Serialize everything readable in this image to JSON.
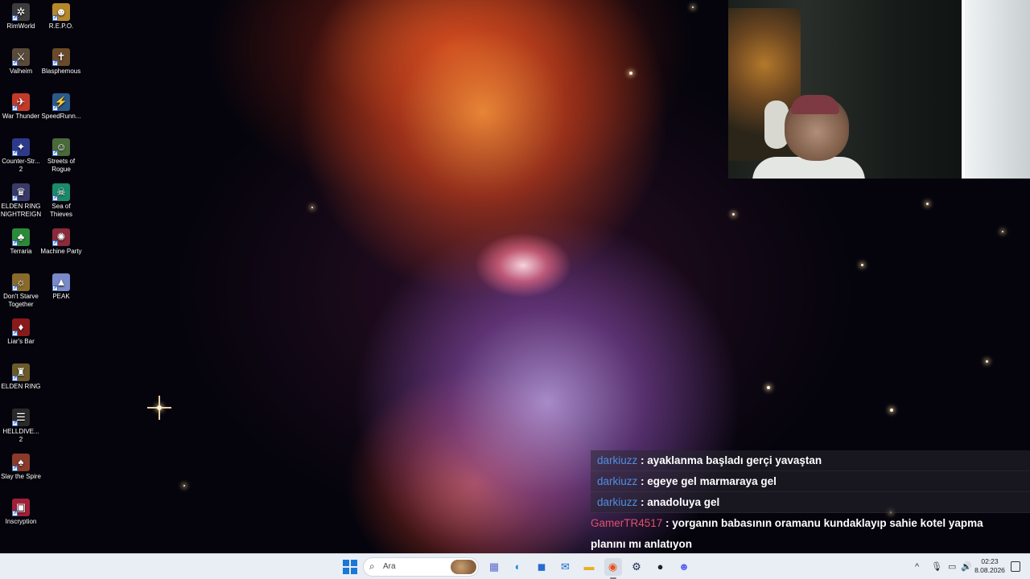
{
  "desktop": {
    "icons": [
      {
        "label": "RimWorld",
        "icon": "rimworld-icon",
        "glyph": "✲",
        "color": "#3c3c3c"
      },
      {
        "label": "R.E.P.O.",
        "icon": "repo-icon",
        "glyph": "☻",
        "color": "#b5872a"
      },
      {
        "label": "Valheim",
        "icon": "valheim-icon",
        "glyph": "⚔",
        "color": "#5a4a3a"
      },
      {
        "label": "Blasphemous",
        "icon": "blasphemous-icon",
        "glyph": "✝",
        "color": "#6b4a2b"
      },
      {
        "label": "War Thunder",
        "icon": "war-thunder-icon",
        "glyph": "✈",
        "color": "#c23a2a"
      },
      {
        "label": "SpeedRunn...",
        "icon": "speedrunners-icon",
        "glyph": "⚡",
        "color": "#2a5a8a"
      },
      {
        "label": "Counter-Str... 2",
        "icon": "counter-strike-icon",
        "glyph": "✦",
        "color": "#2d3a8c"
      },
      {
        "label": "Streets of Rogue",
        "icon": "streets-of-rogue-icon",
        "glyph": "☺",
        "color": "#4a6a3a"
      },
      {
        "label": "ELDEN RING NIGHTREIGN",
        "icon": "nightreign-icon",
        "glyph": "♛",
        "color": "#3a3a6a"
      },
      {
        "label": "Sea of Thieves",
        "icon": "sea-of-thieves-icon",
        "glyph": "☠",
        "color": "#1a8a6a"
      },
      {
        "label": "Terraria",
        "icon": "terraria-icon",
        "glyph": "♣",
        "color": "#2a8a3a"
      },
      {
        "label": "Machine Party",
        "icon": "machine-party-icon",
        "glyph": "✺",
        "color": "#8a2a3a"
      },
      {
        "label": "Don't Starve Together",
        "icon": "dont-starve-icon",
        "glyph": "☼",
        "color": "#8a6a2a"
      },
      {
        "label": "PEAK",
        "icon": "peak-icon",
        "glyph": "▲",
        "color": "#7a8ac8"
      },
      {
        "label": "Liar's Bar",
        "icon": "liars-bar-icon",
        "glyph": "♦",
        "color": "#8a1a1a"
      },
      {
        "label": "ELDEN RING",
        "icon": "elden-ring-icon",
        "glyph": "♜",
        "color": "#6a5a2a"
      },
      {
        "label": "HELLDIVE... 2",
        "icon": "helldivers-icon",
        "glyph": "☰",
        "color": "#2a2a2a"
      },
      {
        "label": "Slay the Spire",
        "icon": "slay-the-spire-icon",
        "glyph": "♠",
        "color": "#8a3a2a"
      },
      {
        "label": "Inscryption",
        "icon": "inscryption-icon",
        "glyph": "▣",
        "color": "#a0203a"
      }
    ]
  },
  "chat": {
    "messages": [
      {
        "user": "darkiuzz",
        "text": " : ayaklanma başladı gerçi yavaştan",
        "user_color": "#4f8fe0"
      },
      {
        "user": "darkiuzz",
        "text": " : egeye gel marmaraya gel",
        "user_color": "#4f8fe0"
      },
      {
        "user": "darkiuzz",
        "text": " : anadoluya gel",
        "user_color": "#4f8fe0"
      },
      {
        "user": "GamerTR4517",
        "text": " : yorganın babasının oramanu kundaklayıp sahie kotel yapma",
        "user_color": "#e0506a"
      },
      {
        "user": "",
        "text": "planını mı anlatıyon",
        "user_color": "#e0506a"
      }
    ]
  },
  "taskbar": {
    "search_placeholder": "Ara",
    "apps": [
      {
        "name": "widgets-app",
        "glyph": "▦",
        "color": "#5a6acf"
      },
      {
        "name": "edge-app",
        "glyph": "◐",
        "color": "#1a8ae0"
      },
      {
        "name": "store-app",
        "glyph": "◼",
        "color": "#2a6ad0"
      },
      {
        "name": "outlook-app",
        "glyph": "✉",
        "color": "#1a6ac8"
      },
      {
        "name": "explorer-app",
        "glyph": "▬",
        "color": "#e8b020"
      },
      {
        "name": "firefox-app",
        "glyph": "◉",
        "color": "#e8501a"
      },
      {
        "name": "steam-app",
        "glyph": "⚙",
        "color": "#1a2a4a"
      },
      {
        "name": "obs-app",
        "glyph": "●",
        "color": "#222"
      },
      {
        "name": "discord-app",
        "glyph": "☻",
        "color": "#5865f2"
      }
    ],
    "tray": {
      "chevron": "^",
      "mic": "🎙",
      "network": "▭",
      "volume": "🔊"
    },
    "clock": {
      "time": "02:23",
      "date": "8.08.2026"
    }
  }
}
